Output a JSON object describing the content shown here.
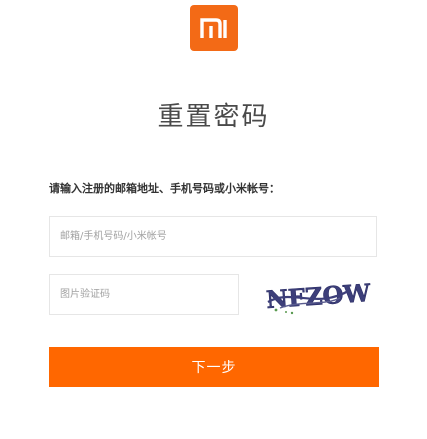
{
  "brand": {
    "logo_text": "mi",
    "accent_color": "#f36a16",
    "button_color": "#ff6700"
  },
  "header": {
    "title": "重置密码"
  },
  "form": {
    "instruction": "请输入注册的邮箱地址、手机号码或小米帐号：",
    "account_placeholder": "邮箱/手机号码/小米帐号",
    "account_value": "",
    "captcha_placeholder": "图片验证码",
    "captcha_value": "",
    "captcha_image_text": "NFZOW",
    "next_label": "下一步"
  }
}
